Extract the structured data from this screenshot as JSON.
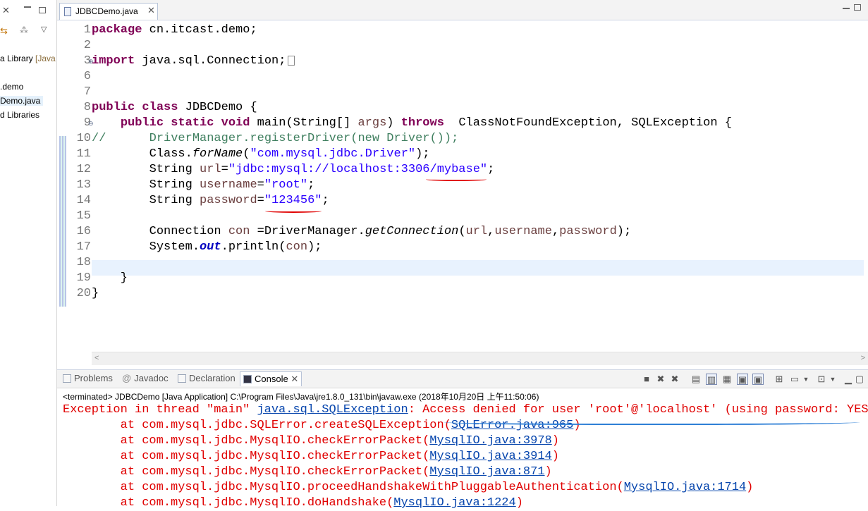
{
  "explorer": {
    "items": [
      {
        "label": "a Library",
        "decoration": "[Java"
      },
      {
        "label": ".demo"
      },
      {
        "label": "Demo.java",
        "selected": true
      },
      {
        "label": "d Libraries"
      }
    ]
  },
  "editor": {
    "tab_title": "JDBCDemo.java",
    "line_numbers": [
      "1",
      "2",
      "3",
      "6",
      "7",
      "8",
      "9",
      "10",
      "11",
      "12",
      "13",
      "14",
      "15",
      "16",
      "17",
      "18",
      "19",
      "20"
    ],
    "lines": {
      "l1_kw": "package",
      "l1_rest": " cn.itcast.demo;",
      "l3_kw": "import",
      "l3_rest": " java.sql.Connection;",
      "l8_kw": "public class",
      "l8_rest": " JDBCDemo {",
      "l9_indent": "    ",
      "l9_kw": "public static void",
      "l9_a": " main(String[] ",
      "l9_var": "args",
      "l9_b": ") ",
      "l9_kw2": "throws",
      "l9_c": "  ClassNotFoundException, SQLException {",
      "l10": "//      DriverManager.registerDriver(new Driver());",
      "l11_a": "        Class.",
      "l11_it": "forName",
      "l11_b": "(",
      "l11_str": "\"com.mysql.jdbc.Driver\"",
      "l11_c": ");",
      "l12_a": "        String ",
      "l12_var": "url",
      "l12_b": "=",
      "l12_str": "\"jdbc:mysql://localhost:3306/mybase\"",
      "l12_c": ";",
      "l13_a": "        String ",
      "l13_var": "username",
      "l13_b": "=",
      "l13_str": "\"root\"",
      "l13_c": ";",
      "l14_a": "        String ",
      "l14_var": "password",
      "l14_b": "=",
      "l14_str": "\"123456\"",
      "l14_c": ";",
      "l16_a": "        Connection ",
      "l16_var": "con",
      "l16_b": " =DriverManager.",
      "l16_it": "getConnection",
      "l16_c": "(",
      "l16_v1": "url",
      "l16_d": ",",
      "l16_v2": "username",
      "l16_e": ",",
      "l16_v3": "password",
      "l16_f": ");",
      "l17_a": "        System.",
      "l17_fld": "out",
      "l17_b": ".println(",
      "l17_var": "con",
      "l17_c": ");",
      "l19": "    }",
      "l20": "}"
    }
  },
  "console": {
    "tabs": {
      "problems": "Problems",
      "javadoc": "Javadoc",
      "declaration": "Declaration",
      "console": "Console"
    },
    "status": "<terminated> JDBCDemo [Java Application] C:\\Program Files\\Java\\jre1.8.0_131\\bin\\javaw.exe (2018年10月20日 上午11:50:06)",
    "exception": {
      "prefix": "Exception in thread \"main\" ",
      "link": "java.sql.SQLException",
      "message": ": Access denied for user 'root'@'localhost' (using password: YES)"
    },
    "stack": [
      {
        "at": "\tat com.mysql.jdbc.SQLError.createSQLException(",
        "link": "SQLError.java:965",
        "end": ")"
      },
      {
        "at": "\tat com.mysql.jdbc.MysqlIO.checkErrorPacket(",
        "link": "MysqlIO.java:3978",
        "end": ")"
      },
      {
        "at": "\tat com.mysql.jdbc.MysqlIO.checkErrorPacket(",
        "link": "MysqlIO.java:3914",
        "end": ")"
      },
      {
        "at": "\tat com.mysql.jdbc.MysqlIO.checkErrorPacket(",
        "link": "MysqlIO.java:871",
        "end": ")"
      },
      {
        "at": "\tat com.mysql.jdbc.MysqlIO.proceedHandshakeWithPluggableAuthentication(",
        "link": "MysqlIO.java:1714",
        "end": ")"
      },
      {
        "at": "\tat com.mysql.jdbc.MysqlIO.doHandshake(",
        "link": "MysqlIO.java:1224",
        "end": ")"
      }
    ]
  },
  "colors": {
    "error": "#e00000",
    "link": "#0645ad",
    "keyword": "#7f0055",
    "string": "#2a00ff",
    "comment": "#3f7f5f"
  }
}
